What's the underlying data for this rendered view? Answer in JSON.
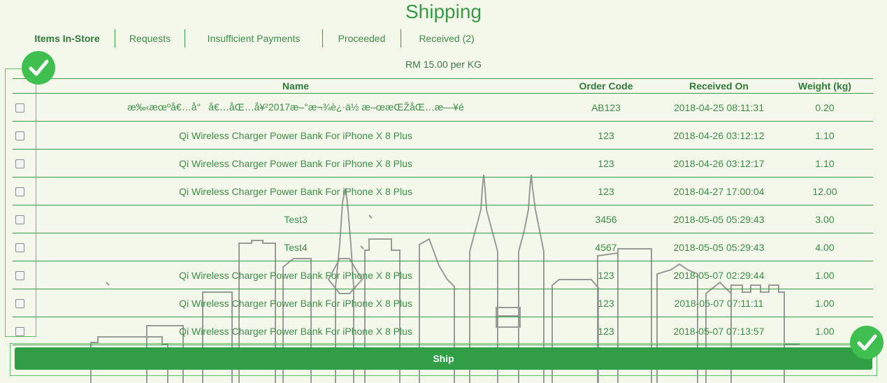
{
  "page": {
    "title": "Shipping",
    "rate": "RM 15.00 per KG"
  },
  "tabs": [
    {
      "label": "Items In-Store",
      "active": true
    },
    {
      "label": "Requests"
    },
    {
      "label": "Insufficient Payments"
    },
    {
      "label": "Proceeded"
    },
    {
      "label": "Received (2)"
    }
  ],
  "table": {
    "headers": {
      "name": "Name",
      "order_code": "Order Code",
      "received_on": "Received On",
      "weight": "Weight (kg)"
    },
    "rows": [
      {
        "name": "æ‰‹æœºå€…å°å€…åŒ…å¥²2017æ–°æ¬¾è¿·ä½ æ–œæŒŽåŒ…æ—¥é",
        "order_code": "AB123",
        "received_on": "2018-04-25 08:11:31",
        "weight": "0.20"
      },
      {
        "name": "Qi Wireless Charger Power Bank For iPhone X 8 Plus",
        "order_code": "123",
        "received_on": "2018-04-26 03:12:12",
        "weight": "1.10"
      },
      {
        "name": "Qi Wireless Charger Power Bank For iPhone X 8 Plus",
        "order_code": "123",
        "received_on": "2018-04-26 03:12:17",
        "weight": "1.10"
      },
      {
        "name": "Qi Wireless Charger Power Bank For iPhone X 8 Plus",
        "order_code": "123",
        "received_on": "2018-04-27 17:00:04",
        "weight": "12.00"
      },
      {
        "name": "Test3",
        "order_code": "3456",
        "received_on": "2018-05-05 05:29:43",
        "weight": "3.00"
      },
      {
        "name": "Test4",
        "order_code": "4567",
        "received_on": "2018-05-05 05:29:43",
        "weight": "4.00"
      },
      {
        "name": "Qi Wireless Charger Power Bank For iPhone X 8 Plus",
        "order_code": "123",
        "received_on": "2018-05-07 02:29:44",
        "weight": "1.00"
      },
      {
        "name": "Qi Wireless Charger Power Bank For iPhone X 8 Plus",
        "order_code": "123",
        "received_on": "2018-05-07 07:11:11",
        "weight": "1.00"
      },
      {
        "name": "Qi Wireless Charger Power Bank For iPhone X 8 Plus",
        "order_code": "123",
        "received_on": "2018-05-07 07:13:57",
        "weight": "1.00"
      }
    ]
  },
  "actions": {
    "ship_label": "Ship"
  },
  "icons": {
    "selection_badge": "checkmark-icon",
    "ship_badge": "checkmark-icon"
  },
  "colors": {
    "accent": "#2f9e44",
    "background": "#f4f8ea",
    "badge": "#3fbf4f"
  }
}
